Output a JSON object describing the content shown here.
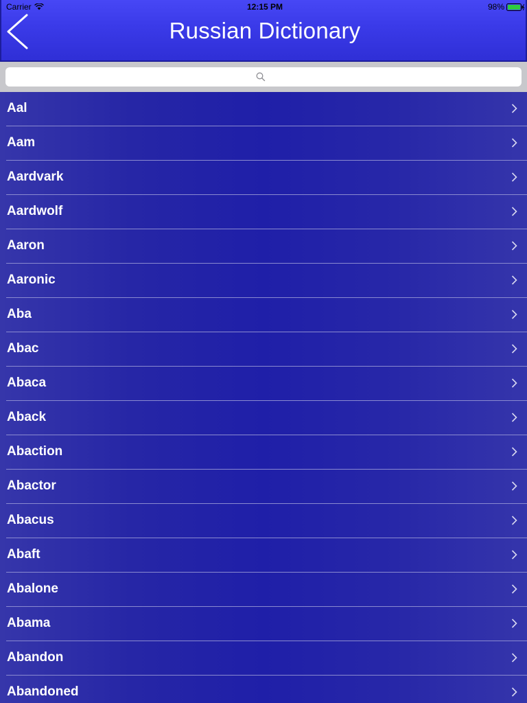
{
  "status_bar": {
    "carrier": "Carrier",
    "time": "12:15 PM",
    "battery": "98%"
  },
  "nav": {
    "title": "Russian Dictionary",
    "back_icon": "chevron-left-icon"
  },
  "search": {
    "placeholder": "",
    "icon": "search-icon"
  },
  "colors": {
    "header": "#3a3ae8",
    "list_background": "#2424a8",
    "search_background": "#c8c8cc"
  },
  "words": [
    "Aal",
    "Aam",
    "Aardvark",
    "Aardwolf",
    "Aaron",
    "Aaronic",
    "Aba",
    "Abac",
    "Abaca",
    "Aback",
    "Abaction",
    "Abactor",
    "Abacus",
    "Abaft",
    "Abalone",
    "Abama",
    "Abandon",
    "Abandoned"
  ]
}
